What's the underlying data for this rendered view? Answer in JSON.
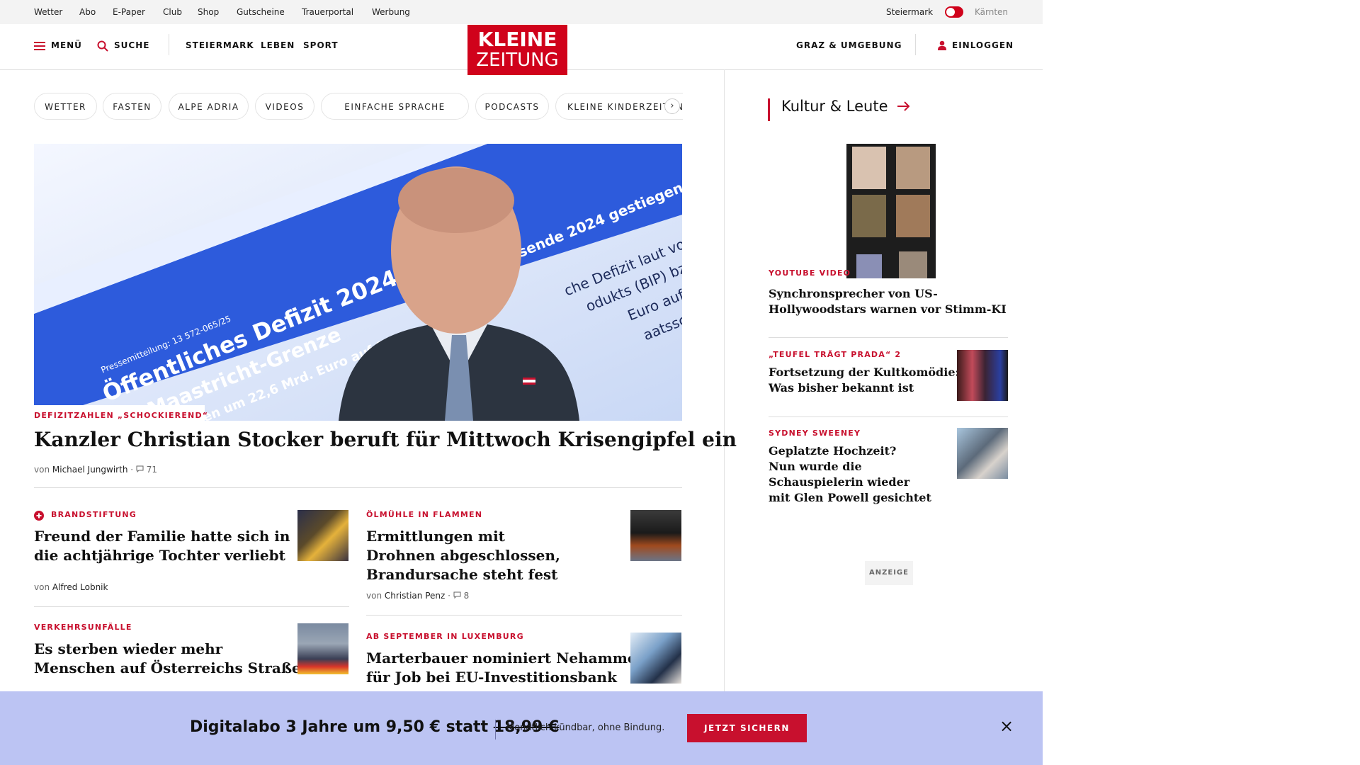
{
  "topbar": {
    "links": [
      "Wetter",
      "Abo",
      "E-Paper",
      "Club",
      "Shop",
      "Gutscheine",
      "Trauerportal",
      "Werbung"
    ],
    "region_left": "Steiermark",
    "region_right": "Kärnten"
  },
  "header": {
    "menu": "MENÜ",
    "search": "SUCHE",
    "nav": [
      "STEIERMARK",
      "LEBEN",
      "SPORT"
    ],
    "logo_line1": "KLEINE",
    "logo_line2": "ZEITUNG",
    "local": "GRAZ & UMGEBUNG",
    "login": "EINLOGGEN"
  },
  "chips": [
    "WETTER",
    "FASTEN",
    "ALPE ADRIA",
    "VIDEOS",
    "EINFACHE SPRACHE",
    "PODCASTS",
    "KLEINE KINDERZEITUNG"
  ],
  "hero": {
    "image_text_1": "Öffentliches Defizit 2024",
    "image_text_2": "Maastricht-Grenze",
    "image_text_3": "Schulden um 22,6 Mrd. Euro auf 3",
    "image_text_4": "Pressemitteilung: 13 572-065/25",
    "image_text_5": "sende 2024 gestiegen",
    "image_text_6": "che Defizit laut vorläu",
    "image_text_7": "odukts (BIP) bzw. 2",
    "image_text_8": "Euro auf 39",
    "image_text_9": "aatsschul",
    "kicker": "DEFIZITZAHLEN „SCHOCKIEREND“",
    "title": "Kanzler Christian Stocker beruft für Mittwoch Krisengipfel ein",
    "by": "von",
    "author": "Michael Jungwirth",
    "comments": "71"
  },
  "articles": [
    {
      "kicker": "BRANDSTIFTUNG",
      "title_l1": "Freund der Familie hatte sich in",
      "title_l2": "die achtjährige Tochter verliebt",
      "by": "von",
      "author": "Alfred Lobnik"
    },
    {
      "kicker": "ÖLMÜHLE IN FLAMMEN",
      "title_l1": "Ermittlungen mit",
      "title_l2": "Drohnen abgeschlossen,",
      "title_l3": "Brandursache steht fest",
      "by": "von",
      "author": "Christian Penz",
      "comments": "8"
    },
    {
      "kicker": "VERKEHRSUNFÄLLE",
      "title_l1": "Es sterben wieder mehr",
      "title_l2": "Menschen auf Österreichs Straßen"
    },
    {
      "kicker": "AB SEPTEMBER IN LUXEMBURG",
      "title_l1": "Marterbauer nominiert Nehammer",
      "title_l2": "für Job bei EU-Investitionsbank"
    }
  ],
  "sidebar": {
    "title": "Kultur & Leute",
    "items": [
      {
        "kicker": "YOUTUBE VIDEO",
        "title_l1": "Synchronsprecher von US-",
        "title_l2": "Hollywoodstars warnen vor Stimm-KI"
      },
      {
        "kicker": "„TEUFEL TRÄGT PRADA“ 2",
        "title_l1": "Fortsetzung der Kultkomödie:",
        "title_l2": "Was bisher bekannt ist"
      },
      {
        "kicker": "SYDNEY SWEENEY",
        "title_l1": "Geplatzte Hochzeit?",
        "title_l2": "Nun wurde die",
        "title_l3": "Schauspielerin wieder",
        "title_l4": "mit Glen Powell gesichtet"
      }
    ],
    "ad_label": "ANZEIGE"
  },
  "promo": {
    "text": "Digitalabo 3 Jahre um 9,50 € statt",
    "old_price": "18,99 €",
    "sub": "Monatlich kündbar, ohne Bindung.",
    "button": "JETZT SICHERN"
  },
  "colors": {
    "brand_red": "#c8102e",
    "promo_bg": "#bcc4f3"
  }
}
